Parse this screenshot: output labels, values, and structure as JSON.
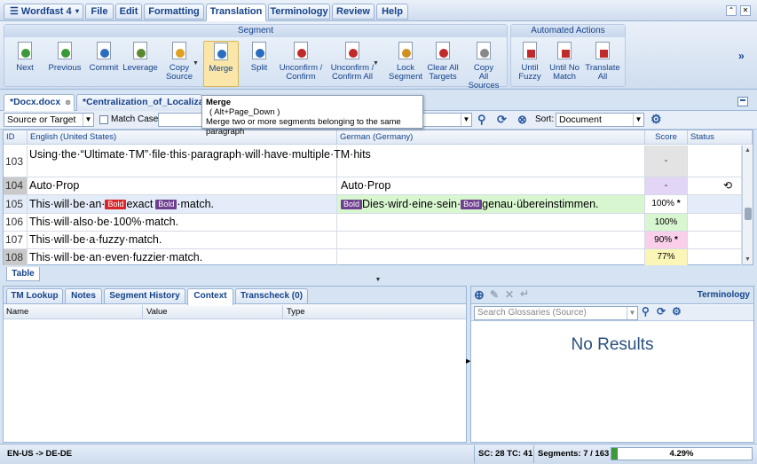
{
  "menubar": {
    "app_menu": "Wordfast 4",
    "tabs": [
      "File",
      "Edit",
      "Formatting",
      "Translation",
      "Terminology",
      "Review",
      "Help"
    ],
    "active_tab": "Translation"
  },
  "ribbon": {
    "segment_group_title": "Segment",
    "automated_group_title": "Automated Actions",
    "segment_buttons": [
      {
        "label1": "Next",
        "label2": ""
      },
      {
        "label1": "Previous",
        "label2": ""
      },
      {
        "label1": "Commit",
        "label2": ""
      },
      {
        "label1": "Leverage",
        "label2": ""
      },
      {
        "label1": "Copy",
        "label2": "Source"
      },
      {
        "label1": "Merge",
        "label2": ""
      },
      {
        "label1": "Split",
        "label2": ""
      },
      {
        "label1": "Unconfirm /",
        "label2": "Confirm"
      },
      {
        "label1": "Unconfirm /",
        "label2": "Confirm All"
      },
      {
        "label1": "Lock",
        "label2": "Segment"
      },
      {
        "label1": "Clear All",
        "label2": "Targets"
      },
      {
        "label1": "Copy",
        "label2": "All Sources"
      }
    ],
    "auto_buttons": [
      {
        "label1": "Until",
        "label2": "Fuzzy"
      },
      {
        "label1": "Until No",
        "label2": "Match"
      },
      {
        "label1": "Translate",
        "label2": "All"
      }
    ],
    "more": "»"
  },
  "doctabs": [
    "*Docx.docx",
    "*Centralization_of_Localizati"
  ],
  "tooltip": {
    "title": "Merge",
    "shortcut": "( Alt+Page_Down )",
    "description": "Merge two or more segments belonging to the same paragraph"
  },
  "filter": {
    "scope": "Source or Target",
    "match_case_label": "Match Case",
    "sort_label": "Sort:",
    "sort_value": "Document"
  },
  "grid": {
    "headers": {
      "id": "ID",
      "source": "English (United States)",
      "target": "German (Germany)",
      "score": "Score",
      "status": "Status"
    },
    "rows": [
      {
        "id": "103",
        "source": "Using·the·“Ultimate·TM”·file·this·paragraph·will·have·multiple·TM·hits",
        "target": "",
        "score": "-"
      },
      {
        "id": "104",
        "source": "Auto·Prop",
        "target": "Auto·Prop",
        "score": "-"
      },
      {
        "id": "105",
        "source_a": "This·will·be·an·",
        "source_tag1": "Bold",
        "source_b": "exact",
        "source_tag2": "Bold",
        "source_c": "·match.",
        "target_tag1": "Bold",
        "target_a": "Dies·wird·eine·sein·",
        "target_tag2": "Bold",
        "target_b": "genau·übereinstimmen.",
        "score": "100%",
        "star": "*"
      },
      {
        "id": "106",
        "source": "This·will·also·be·100%·match.",
        "target": "",
        "score": "100%"
      },
      {
        "id": "107",
        "source": "This·will·be·a·fuzzy·match.",
        "target": "",
        "score": "90%",
        "star": "*"
      },
      {
        "id": "108",
        "source": "This·will·be·an·even·fuzzier·match.",
        "target": "",
        "score": "77%"
      }
    ]
  },
  "table_tab": "Table",
  "bottom_left": {
    "tabs": [
      "TM Lookup",
      "Notes",
      "Segment History",
      "Context",
      "Transcheck (0)"
    ],
    "active_tab": "Context",
    "columns": [
      "Name",
      "Value",
      "Type"
    ]
  },
  "bottom_right": {
    "title": "Terminology",
    "search_placeholder": "Search Glossaries (Source)",
    "no_results": "No Results"
  },
  "status": {
    "lang": "EN-US -> DE-DE",
    "sc_tc": "SC: 28 TC: 41",
    "segments": "Segments: 7 / 163",
    "progress": "4.29%",
    "progress_value": 0.0429
  },
  "colors": {
    "accent": "#15428b",
    "score_grey": "#e3e3e3",
    "score_purple": "#e2d5f5",
    "score_green": "#d8f7d0",
    "score_pink": "#f9cfe9",
    "score_yellow": "#fbf6b8",
    "tag_red": "#d9262a",
    "tag_purple": "#6f3f8f"
  }
}
